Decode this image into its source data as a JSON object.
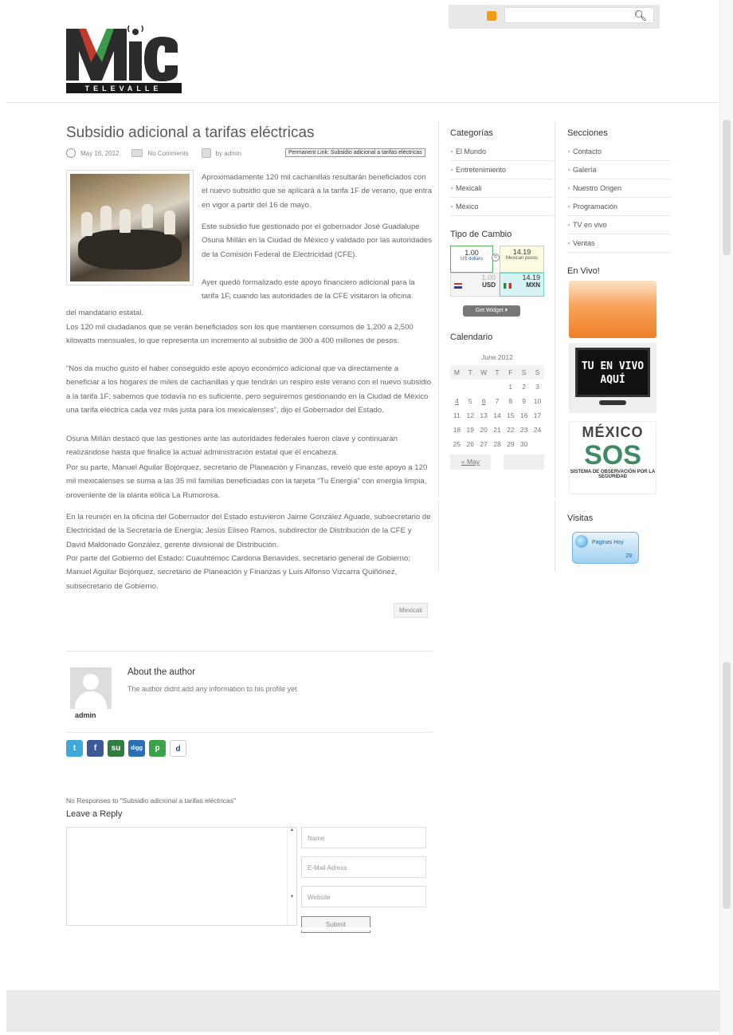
{
  "colors": {
    "accent_green": "#3e8b63",
    "link": "#333333",
    "text": "#666666"
  },
  "search": {
    "placeholder": ""
  },
  "logo": {
    "main": "MiC",
    "sub": "TELEVALLE"
  },
  "post": {
    "title": "Subsidio adicional a tarifas eléctricas",
    "date": "May 16, 2012",
    "comments": "No Comments",
    "author_by": "by admin",
    "tooltip": "Permanent Link: Subsidio adicional a tarifas eléctricas",
    "para1": "Aproximadamente 120 mil cachanillas resultarán beneficiados con el nuevo subsidio que se aplicará a la tarifa 1F de verano, que entra en vigor a partir del 16 de mayo.",
    "para2": "Este subsidio fue gestionado por el gobernador José Guadalupe Osuna Millán en la Ciudad de México y validado por las autoridades de la Comisión Federal de Electricidad (CFE).",
    "para3a": "Ayer quedó formalizado este apoyo financiero adicional para la tarifa 1F, cuando las autoridades de la CFE visitaron la oficina",
    "para3b": "del mandatario estatal.",
    "para4": "Los 120 mil ciudadanos que se verán beneficiados son los que mantienen consumos de 1,200 a 2,500 kilowatts mensuales, lo que representa un incremento al subsidio de 300 a 400 millones de pesos.",
    "para5": "“Nos da mucho gusto el haber conseguido este apoyo económico adicional que va directamente a beneficiar a los hogares de miles de cachanillas y que tendrán un respiro este verano con el nuevo subsidio a la tarifa 1F; sabemos que todavía no es suficiente, pero seguiremos gestionando en la Ciudad de México una tarifa eléctrica cada vez más justa para los mexicalenses”, dijo el Gobernador del Estado.",
    "para6": "Osuna Millán destacó que las gestiones ante las autoridades federales fueron clave y continuarán realizándose hasta que finalice la actual administración estatal que él encabeza.",
    "para7": "Por su parte, Manuel Aguilar Bojórquez, secretario de Planeación y Finanzas, reveló que este apoyo a 120 mil mexicalenses se suma a las 35 mil familias beneficiadas con la tarjeta “Tu Energía” con energía limpia, proveniente de la planta eólica La Rumorosa.",
    "para8": "En la reunión en la oficina del Gobernador del Estado estuvieron Jaime González Aguade, subsecretario de Electricidad de la Secretaría de Energía; Jesús Eliseo Ramos, subdirector de Distribución de la CFE y David Maldonado González, gerente divisional de Distribución.",
    "para9": "Por parte del Gobierno del Estado: Cuauhtémoc Cardona Benavides, secretario general de Gobierno; Manuel Aguilar Bojórquez, secretario de Planeación y Finanzas y Luis Alfonso Vizcarra Quiñónez, subsecretario de Gobierno.",
    "tag": "Mexicali"
  },
  "author_box": {
    "title": "About the author",
    "text": "The author didnt add any information to his profile yet",
    "name": "admin"
  },
  "social": [
    "t",
    "f",
    "su",
    "digg",
    "p",
    "d"
  ],
  "comments": {
    "no_responses": "No Responses to \"Subsidio adicional a tarifas eléctricas\"",
    "leave_reply": "Leave a Reply",
    "name_placeholder": "Name",
    "email_placeholder": "E-Mail Adress",
    "website_placeholder": "Website",
    "submit_label": "Submit"
  },
  "sidebar1": {
    "categories_title": "Categorías",
    "categories": [
      "El Mundo",
      "Entretenimiento",
      "Mexicali",
      "México"
    ],
    "exchange_title": "Tipo de Cambio",
    "fx": {
      "left_val": "1.00",
      "left_label": "US dollars",
      "eq": "=",
      "right_val": "14.19",
      "right_label": "Mexican pesos",
      "left_val2": "1.00",
      "left_cur": "USD",
      "right_val2": "14.19",
      "right_cur": "MXN"
    },
    "get_widget": "Get Widget ⏵",
    "calendar_title": "Calendario",
    "calendar": {
      "caption": "June 2012",
      "headers": [
        "M",
        "T",
        "W",
        "T",
        "F",
        "S",
        "S"
      ],
      "weeks": [
        [
          "",
          "",
          "",
          "",
          "1",
          "2",
          "3"
        ],
        [
          "4",
          "5",
          "6",
          "7",
          "8",
          "9",
          "10"
        ],
        [
          "11",
          "12",
          "13",
          "14",
          "15",
          "16",
          "17"
        ],
        [
          "18",
          "19",
          "20",
          "21",
          "22",
          "23",
          "24"
        ],
        [
          "25",
          "26",
          "27",
          "28",
          "29",
          "30",
          ""
        ]
      ],
      "prev": "« May"
    }
  },
  "sidebar2": {
    "sections_title": "Secciones",
    "sections": [
      "Contacto",
      "Galería",
      "Nuestro Origen",
      "Programación",
      "TV en vivo",
      "Ventas"
    ],
    "live_title": "En Vivo!",
    "tv_text": "TU EN VIVO AQUÍ",
    "sos": {
      "top": "MÉXICO",
      "big": "SOS",
      "sub": "SISTEMA DE OBSERVACIÓN POR LA SEGURIDAD"
    },
    "visits_title": "Visitas",
    "visits": {
      "label": "Paginas Hoy",
      "count": "29"
    }
  }
}
